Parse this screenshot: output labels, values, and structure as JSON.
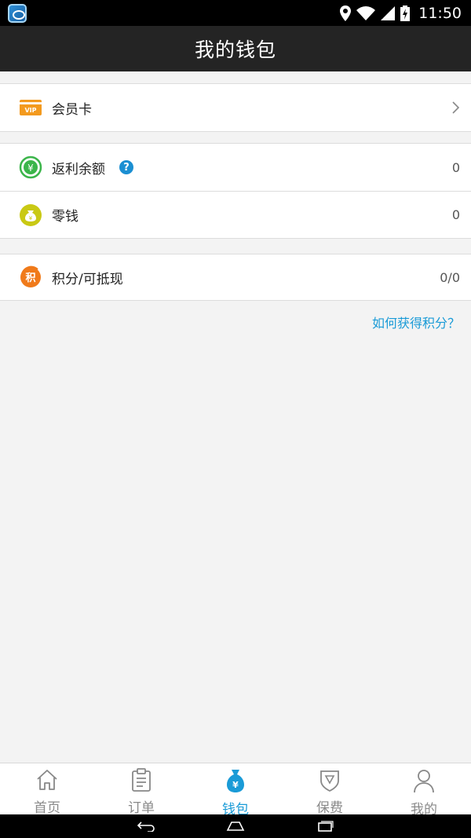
{
  "status": {
    "time": "11:50",
    "icons": [
      "app-notification-icon",
      "location-icon",
      "wifi-icon",
      "signal-icon",
      "battery-charging-icon"
    ]
  },
  "header": {
    "title": "我的钱包"
  },
  "wallet": {
    "vip": {
      "label": "会员卡",
      "icon": "vip-card-icon"
    },
    "rebate": {
      "label": "返利余额",
      "value": "0",
      "icon": "rebate-yuan-icon",
      "help": "?"
    },
    "change": {
      "label": "零钱",
      "value": "0",
      "icon": "money-bag-icon"
    },
    "points": {
      "label": "积分/可抵现",
      "value": "0/0",
      "icon": "points-icon",
      "icon_text": "积"
    },
    "how_link": "如何获得积分？"
  },
  "tabs": [
    {
      "label": "首页",
      "icon": "home-icon",
      "active": false
    },
    {
      "label": "订单",
      "icon": "order-clipboard-icon",
      "active": false
    },
    {
      "label": "钱包",
      "icon": "wallet-bag-icon",
      "active": true
    },
    {
      "label": "保费",
      "icon": "shield-icon",
      "active": false
    },
    {
      "label": "我的",
      "icon": "person-icon",
      "active": false
    }
  ],
  "colors": {
    "accent": "#1a9bd7",
    "header_bg": "#242424",
    "vip_orange": "#f39a1e",
    "rebate_green": "#3bb54a",
    "change_yellow": "#c9c914",
    "points_orange": "#f07a1a"
  }
}
